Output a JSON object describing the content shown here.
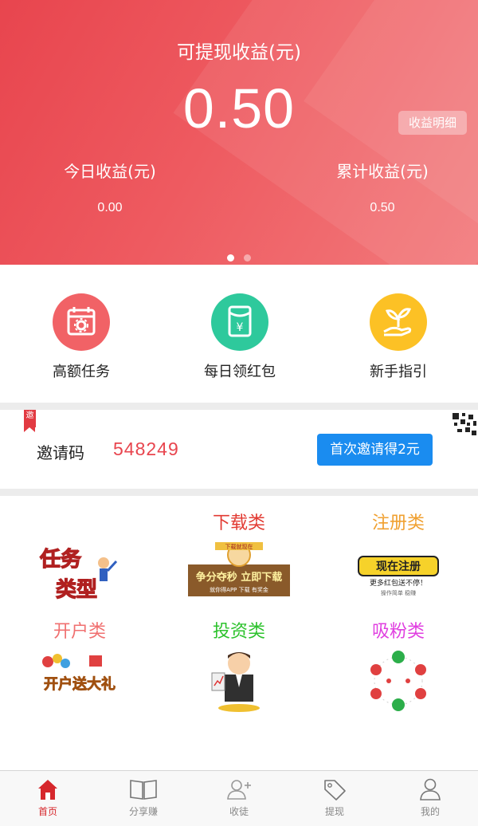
{
  "header": {
    "title": "可提现收益(元)",
    "amount": "0.50",
    "detail_button": "收益明细",
    "today_label": "今日收益(元)",
    "today_value": "0.00",
    "total_label": "累计收益(元)",
    "total_value": "0.50",
    "carousel_active_index": 0,
    "carousel_count": 2
  },
  "actions": [
    {
      "label": "高额任务",
      "icon": "calendar-gear-icon",
      "color": "#f16266"
    },
    {
      "label": "每日领红包",
      "icon": "red-envelope-yen-icon",
      "color": "#2ec99c"
    },
    {
      "label": "新手指引",
      "icon": "hand-plant-icon",
      "color": "#fcc125"
    }
  ],
  "invite": {
    "tag": "邀",
    "label": "邀请码",
    "code": "548249",
    "button": "首次邀请得2元"
  },
  "categories": [
    {
      "name": "",
      "art_text_1": "任务",
      "art_text_2": "类型",
      "color": "#e8454e"
    },
    {
      "name": "下载类",
      "art_text_1": "下载就现在",
      "art_text_2": "争分夺秒 立即下载",
      "art_text_3": "就你得APP 下载 有奖金",
      "color": "#e23a32"
    },
    {
      "name": "注册类",
      "art_text_1": "现在注册",
      "art_text_2": "更多红包送不停！",
      "art_text_3": "操作简单 稳赚",
      "color": "#f0a030"
    },
    {
      "name": "开户类",
      "art_text_1": "开户送大礼",
      "color": "#f07070"
    },
    {
      "name": "投资类",
      "color": "#2cc22c"
    },
    {
      "name": "吸粉类",
      "color": "#e040e0"
    }
  ],
  "tabs": [
    {
      "label": "首页",
      "icon": "home-icon",
      "active": true
    },
    {
      "label": "分享赚",
      "icon": "book-icon",
      "active": false
    },
    {
      "label": "收徒",
      "icon": "add-user-icon",
      "active": false
    },
    {
      "label": "提现",
      "icon": "tag-icon",
      "active": false
    },
    {
      "label": "我的",
      "icon": "user-icon",
      "active": false
    }
  ],
  "colors": {
    "brand_red": "#e8454e",
    "invite_button": "#1a8cf0",
    "tab_active": "#d6272c"
  }
}
